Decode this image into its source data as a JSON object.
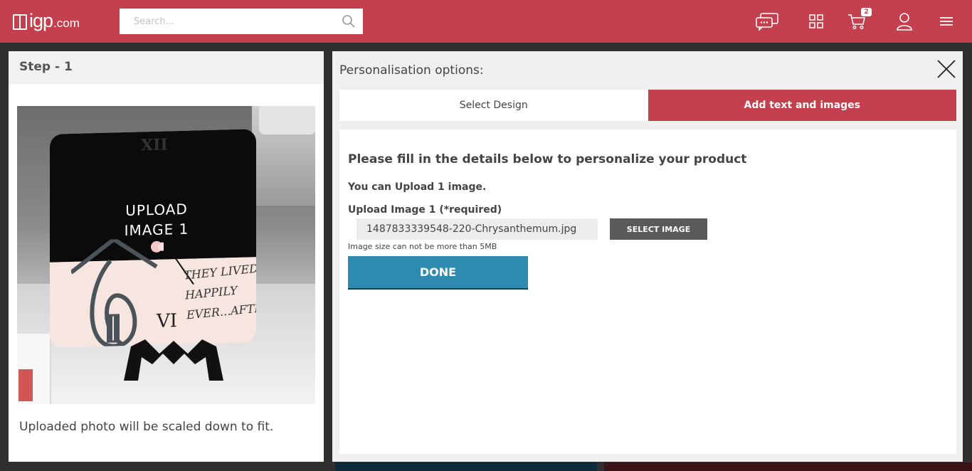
{
  "header": {
    "logo_brand": "igp",
    "logo_tld": ".com",
    "search_placeholder": "Search...",
    "cart_count": "2",
    "icons": [
      "chat-icon",
      "grid-icon",
      "cart-icon",
      "user-icon",
      "menu-icon"
    ],
    "background_color": "#c4404f"
  },
  "left_panel": {
    "step_title": "Step - 1",
    "preview": {
      "upload_label_line1": "UPLOAD",
      "upload_label_line2": "IMAGE 1",
      "roman_top": "XII",
      "roman_bottom": "VI",
      "quote_line1": "THEY LIVED",
      "quote_line2": "HAPPILY",
      "quote_line3": "EVER...AFTER..."
    },
    "note": "Uploaded photo will be scaled down to fit."
  },
  "modal": {
    "title": "Personalisation options:",
    "tabs": [
      {
        "label": "Select Design",
        "active": false
      },
      {
        "label": "Add text and images",
        "active": true
      }
    ],
    "form": {
      "heading": "Please fill in the details below to personalize your product",
      "upload_count_note": "You can Upload 1 image.",
      "field_label": "Upload Image 1 (*required)",
      "filename_value": "1487833339548-220-Chrysanthemum.jpg",
      "select_button": "SELECT IMAGE",
      "size_note": "Image size can not be more than 5MB",
      "done_button": "DONE"
    },
    "accent_color": "#c4404f",
    "done_color": "#2e8aae"
  }
}
